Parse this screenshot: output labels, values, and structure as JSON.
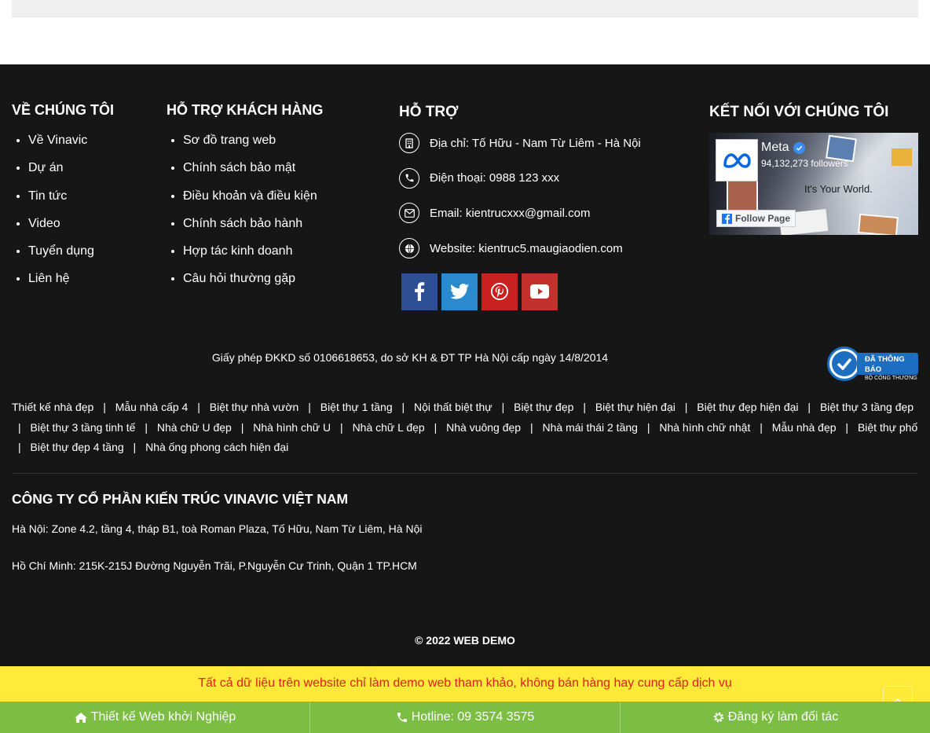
{
  "footer": {
    "about": {
      "title": "VỀ CHÚNG TÔI",
      "items": [
        "Về Vinavic",
        "Dự án",
        "Tin tức",
        "Video",
        "Tuyển dụng",
        "Liên hệ"
      ]
    },
    "support_customers": {
      "title": "HỖ TRỢ KHÁCH HÀNG",
      "items": [
        "Sơ đồ trang web",
        "Chính sách bảo mật",
        "Điều khoản và điều kiện",
        "Chính sách bảo hành",
        "Hợp tác kinh doanh",
        "Câu hỏi thường gặp"
      ]
    },
    "support": {
      "title": "HỖ TRỢ",
      "address": "Địa chỉ: Tố Hữu - Nam Từ Liêm - Hà Nội",
      "phone": "Điện thoại: 0988 123 xxx",
      "email": "Email: kientrucxxx@gmail.com",
      "website": "Website: kientruc5.maugiaodien.com",
      "socials": [
        {
          "icon": "facebook-icon",
          "color": "#2f4f94"
        },
        {
          "icon": "twitter-icon",
          "color": "#2b89ce"
        },
        {
          "icon": "pinterest-icon",
          "color": "#c8211f"
        },
        {
          "icon": "youtube-icon",
          "color": "#c4302b"
        }
      ]
    },
    "connect": {
      "title": "KẾT NỐI VỚI CHÚNG TÔI",
      "page_name": "Meta",
      "followers": "94,132,273 followers",
      "tagline": "It's Your World.",
      "follow_label": "Follow Page"
    },
    "license": "Giấy phép ĐKKD số 0106618653, do sở KH & ĐT TP Hà Nội cấp ngày 14/8/2014",
    "badge": {
      "line1": "ĐÃ THÔNG BÁO",
      "line2": "BỘ CÔNG THƯƠNG"
    },
    "tags": [
      "Thiết kế nhà đẹp",
      "Mẫu nhà cấp 4",
      "Biệt thự nhà vườn",
      "Biệt thự 1 tầng",
      "Nội thất biệt thự",
      "Biệt thự đẹp",
      "Biệt thự hiện đại",
      "Biệt thự đẹp hiện đại",
      "Biệt thự 3 tầng đẹp",
      "Biệt thự 3 tầng tinh tế",
      "Nhà chữ U đẹp",
      "Nhà hình chữ U",
      "Nhà chữ L đẹp",
      "Nhà vuông đẹp",
      "Nhà mái thái 2 tầng",
      "Nhà hình chữ nhật",
      "Mẫu nhà đẹp",
      "Biệt thự phố",
      "Biệt thự đẹp 4 tầng",
      "Nhà ống phong cách hiện đại"
    ],
    "company": "CÔNG TY CỔ PHẦN KIẾN TRÚC VINAVIC VIỆT NAM",
    "hanoi": "Hà Nội: Zone 4.2, tầng 4, tháp B1, toà Roman Plaza, Tố Hữu, Nam Từ Liêm, Hà Nội",
    "hcm": "Hồ Chí Minh: 215K-215J Đường Nguyễn Trãi, P.Nguyễn Cư Trinh, Quận 1 TP.HCM",
    "copyright": "© 2022 WEB DEMO"
  },
  "notice": "Tất cả dữ liệu trên website chỉ làm demo web tham khảo, không bán hàng hay cung cấp dịch vụ",
  "bottom_bar": {
    "item1": "Thiết kế Web khởi Nghiệp",
    "item2": "Hotline: 09 3574 3575",
    "item3": "Đăng ký làm đối tác"
  },
  "colors": {
    "footer_bg": "#161616",
    "notice_bg": "#ffea3a",
    "notice_text": "#e0201a",
    "bottom_bar_bg": "#7cbe43"
  }
}
